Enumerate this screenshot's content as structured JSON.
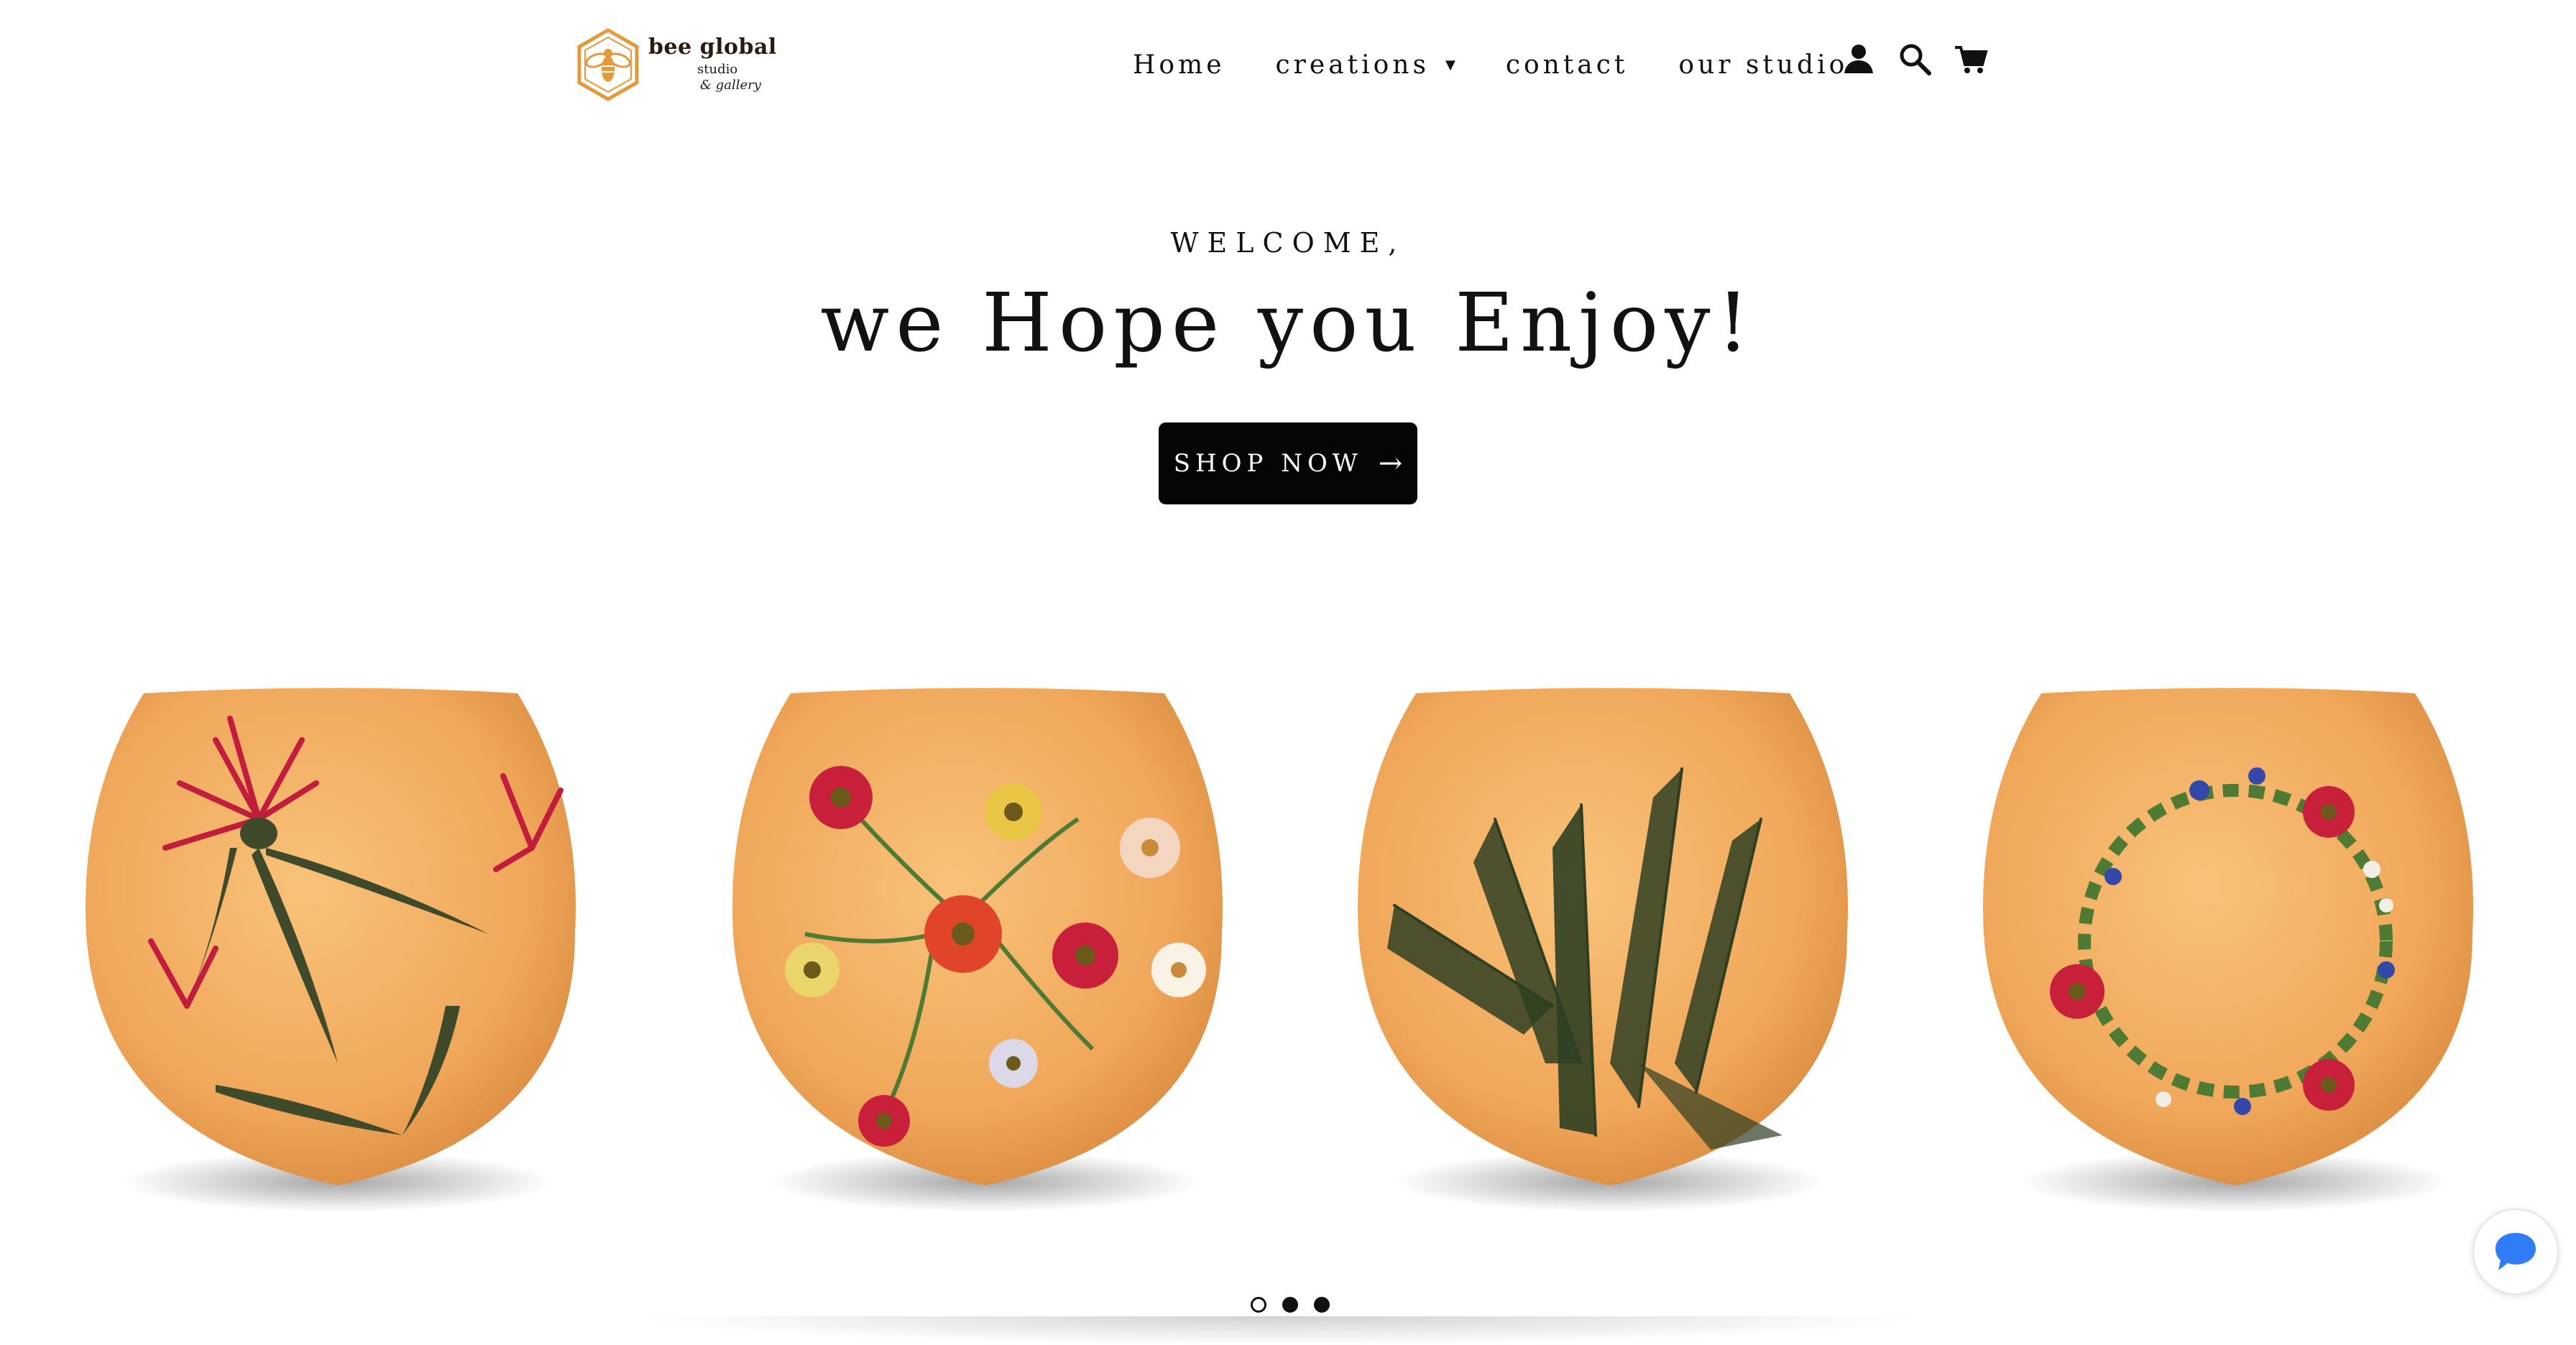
{
  "brand": {
    "name_line1": "bee global",
    "name_line2": "studio",
    "name_line3": "& gallery",
    "accent_color": "#e39a3b"
  },
  "nav": {
    "items": [
      {
        "label": "Home"
      },
      {
        "label": "creations",
        "has_dropdown": true
      },
      {
        "label": "contact"
      },
      {
        "label": "our studio"
      }
    ],
    "icons": [
      "account-icon",
      "search-icon",
      "cart-icon"
    ]
  },
  "hero": {
    "eyebrow": "WELCOME,",
    "headline": "we Hope you Enjoy!",
    "cta_label": "SHOP NOW",
    "cta_arrow": "→"
  },
  "slideshow": {
    "slide_count": 3,
    "active_index": 0,
    "vases": [
      {
        "motif": "red bee balm with leaves"
      },
      {
        "motif": "daisy and red flower bouquet"
      },
      {
        "motif": "green fern fronds"
      },
      {
        "motif": "floral wreath"
      }
    ]
  },
  "chat": {
    "icon": "chat-bubble-icon",
    "color": "#2f7cf6"
  }
}
